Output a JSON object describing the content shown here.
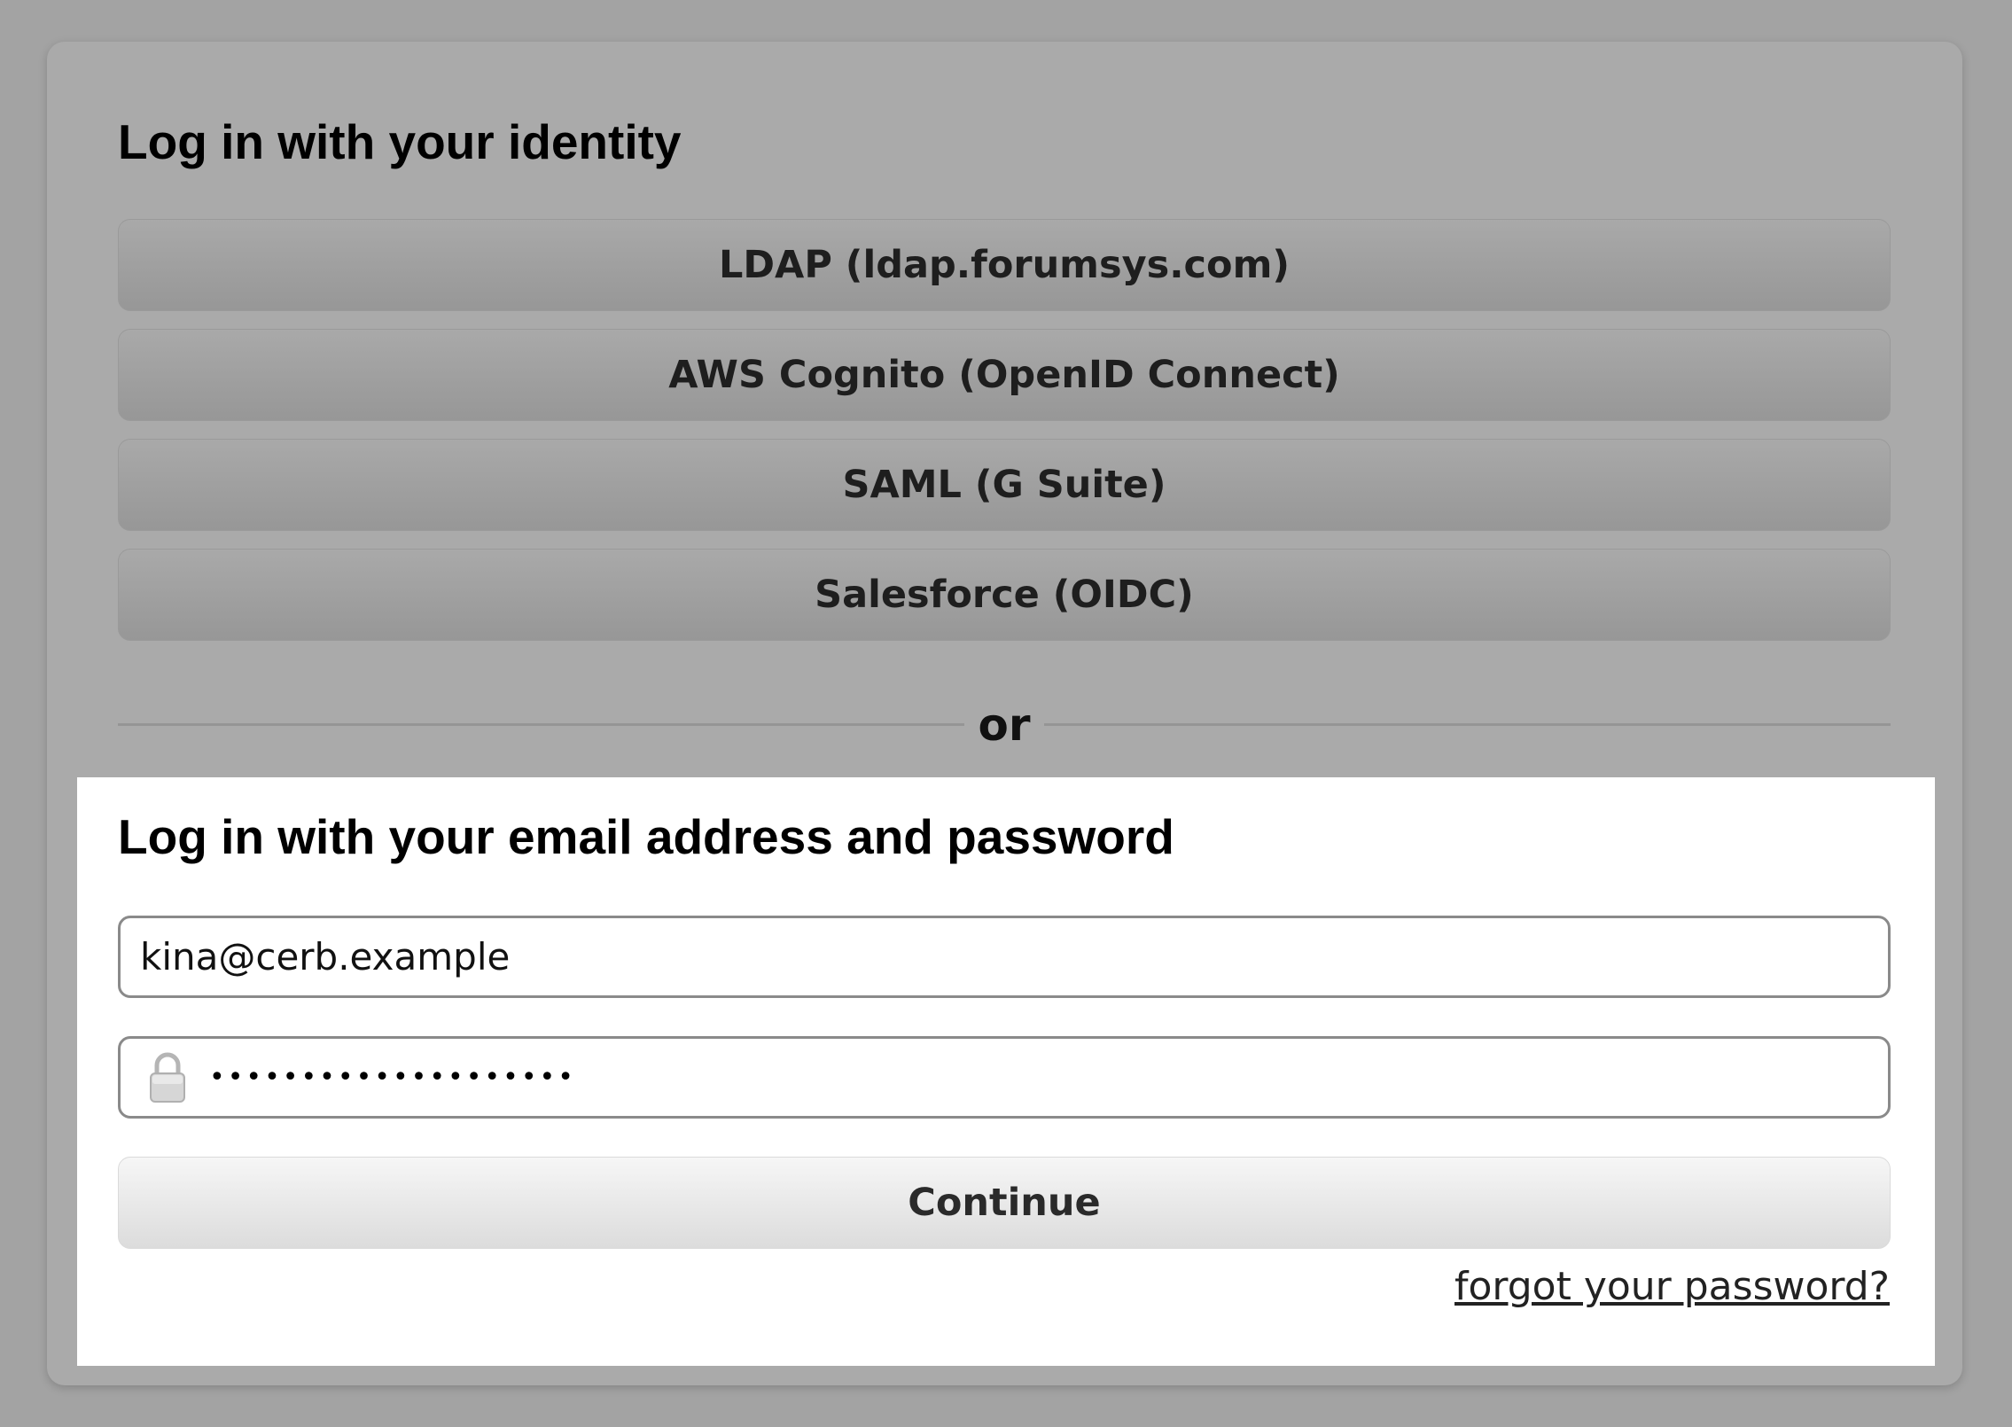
{
  "identity_section": {
    "heading": "Log in with your identity",
    "providers": [
      {
        "label": "LDAP (ldap.forumsys.com)"
      },
      {
        "label": "AWS Cognito (OpenID Connect)"
      },
      {
        "label": "SAML (G Suite)"
      },
      {
        "label": "Salesforce (OIDC)"
      }
    ]
  },
  "divider": {
    "label": "or"
  },
  "password_section": {
    "heading": "Log in with your email address and password",
    "email_value": "kina@cerb.example",
    "password_mask": "••••••••••••••••••••",
    "lock_icon": "lock-icon",
    "continue_label": "Continue",
    "forgot_label": "forgot your password?"
  },
  "colors": {
    "page_background": "#a3a3a3",
    "card_background": "#aaaaaa",
    "panel_background": "#ffffff",
    "button_identity": "#a0a0a0",
    "button_continue": "#e8e8e8"
  }
}
